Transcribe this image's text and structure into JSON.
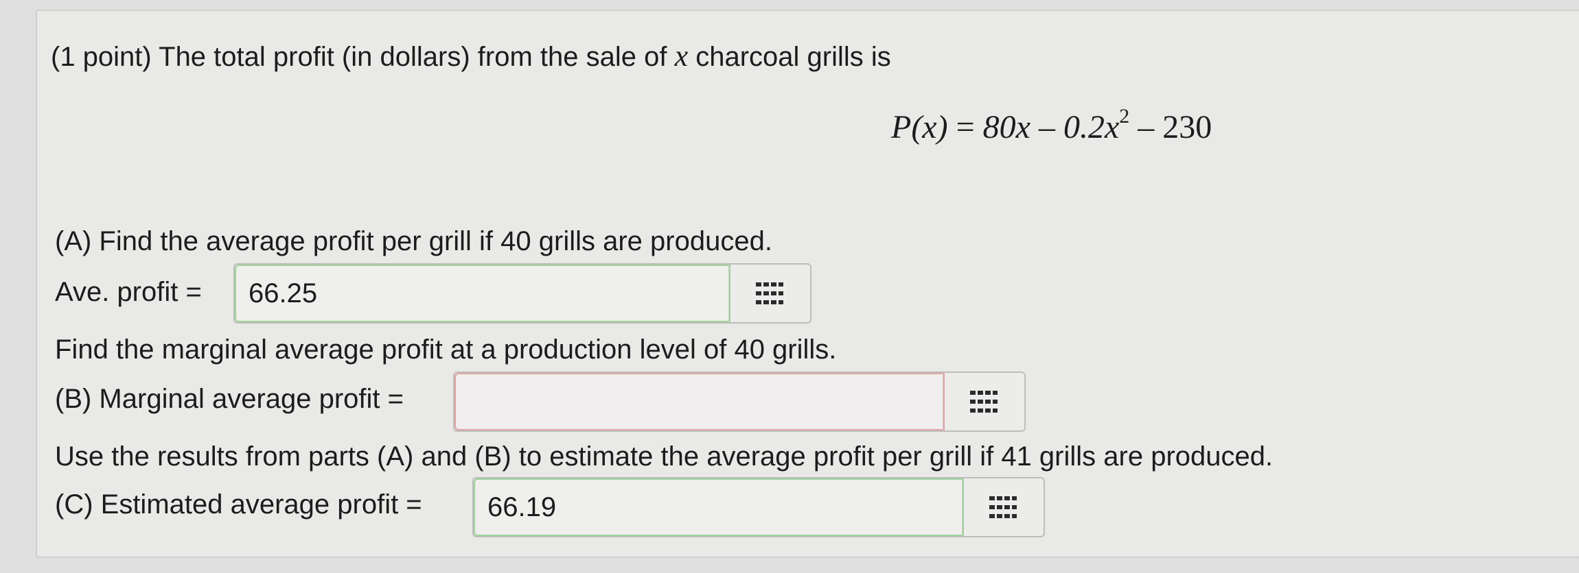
{
  "question": {
    "intro": "(1 point) The total profit (in dollars) from the sale of",
    "intro_var": "x",
    "intro_end": "charcoal grills is",
    "formula": {
      "lhs": "P(x)",
      "eq": "=",
      "term1": "80x",
      "minus1": "–",
      "term2_base": "0.2x",
      "term2_exp": "2",
      "minus2": "–",
      "term3": "230"
    }
  },
  "part_a": {
    "prompt": "(A) Find the average profit per grill if 40 grills are produced.",
    "label": "Ave. profit =",
    "value": "66.25"
  },
  "part_b": {
    "prompt": "Find the marginal average profit at a production level of 40 grills.",
    "label": "(B) Marginal average profit =",
    "value": ""
  },
  "part_c": {
    "prompt": "Use the results from parts (A) and (B) to estimate the average profit per grill if 41 grills are produced.",
    "label": "(C) Estimated average profit =",
    "value": "66.19"
  },
  "icons": {
    "entry_palette": "grid-keypad-icon"
  },
  "colors": {
    "correct_border": "#9fd39a",
    "empty_border": "#e2a3a3"
  }
}
